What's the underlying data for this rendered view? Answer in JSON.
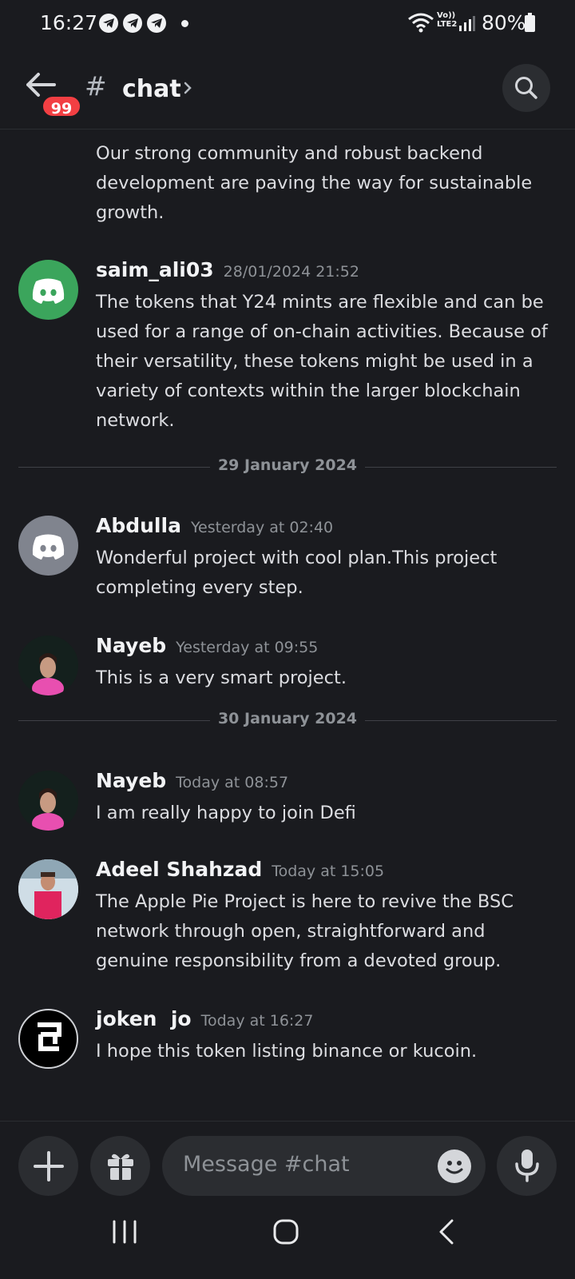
{
  "status_bar": {
    "time": "16:27",
    "battery": "80%",
    "network": "Vo)) LTE2",
    "notification_icons": [
      "telegram-icon",
      "telegram-icon",
      "telegram-icon"
    ]
  },
  "header": {
    "unread_badge": "99",
    "channel_prefix": "#",
    "channel_name": "chat"
  },
  "messages": {
    "continuation": "Our strong community and robust backend development are paving the way for sustainable growth.",
    "m1": {
      "author": "saim_ali03",
      "time": "28/01/2024 21:52",
      "text": "The tokens that Y24 mints are flexible and can be used for a range of on-chain activities. Because of their versatility, these tokens might be used in a variety of contexts within the larger blockchain network."
    },
    "divider1": "29 January 2024",
    "m2": {
      "author": "Abdulla",
      "time": "Yesterday at 02:40",
      "text": "Wonderful project with cool plan.This project completing every step."
    },
    "m3": {
      "author": "Nayeb",
      "time": "Yesterday at 09:55",
      "text": "This is a very smart project."
    },
    "divider2": "30 January 2024",
    "m4": {
      "author": "Nayeb",
      "time": "Today at 08:57",
      "text": "I am really happy to join Defi"
    },
    "m5": {
      "author": "Adeel Shahzad",
      "time": "Today at 15:05",
      "text": "The Apple Pie Project is here to revive the BSC network through open, straightforward and genuine responsibility from a devoted group."
    },
    "m6": {
      "author": "joken  jo",
      "time": "Today at 16:27",
      "text": "I hope this token listing binance or kucoin."
    }
  },
  "input_bar": {
    "placeholder": "Message #chat"
  },
  "colors": {
    "background": "#1a1b1f",
    "surface": "#2b2d31",
    "badge_red": "#f23f43",
    "discord_green": "#3ba55c",
    "discord_grey": "#80848e"
  }
}
